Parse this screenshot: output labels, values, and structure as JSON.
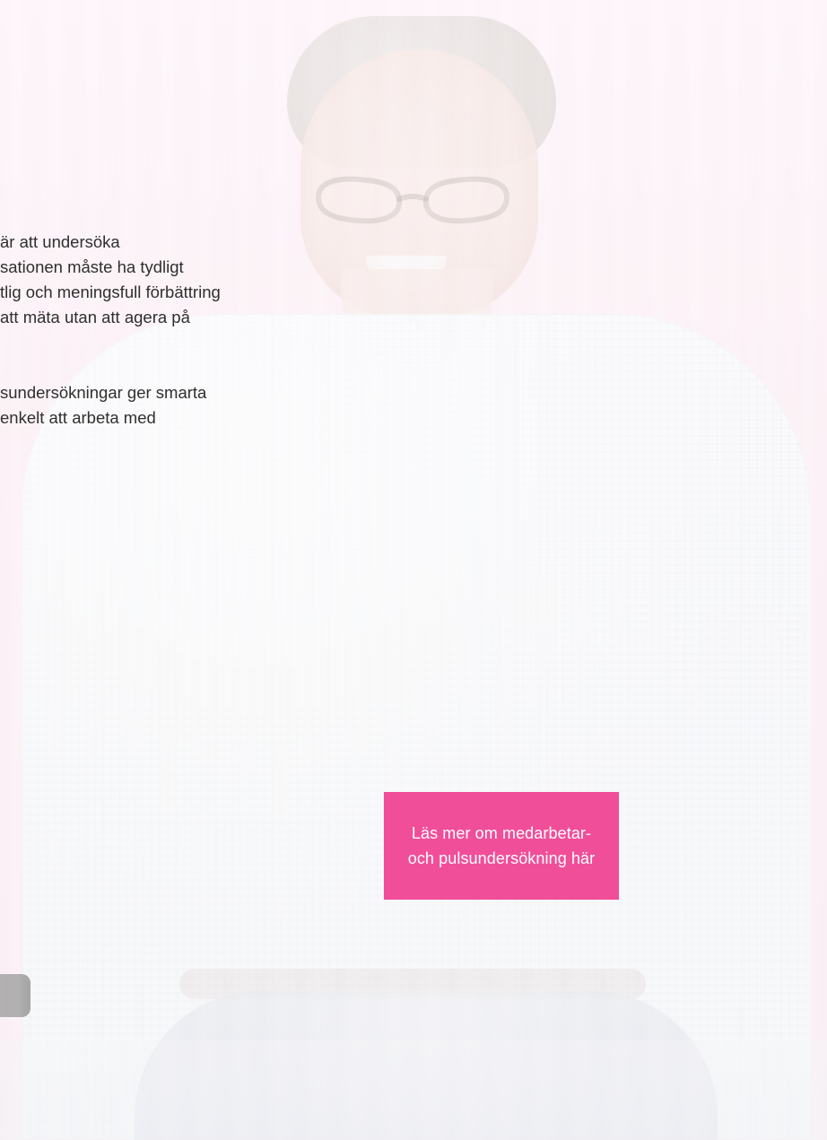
{
  "content": {
    "text_lines": [
      "är att undersöka",
      "sationen måste ha tydligt",
      "tlig och meningsfull förbättring",
      "att mäta utan att agera på",
      "sundersökningar ger smarta",
      "enkelt att arbeta med"
    ]
  },
  "cta": {
    "line1": "Läs mer om medarbetar-",
    "line2": "och pulsundersökning här"
  },
  "colors": {
    "cta_bg": "#f14e9a",
    "background_tint": "#f7e1ec"
  }
}
